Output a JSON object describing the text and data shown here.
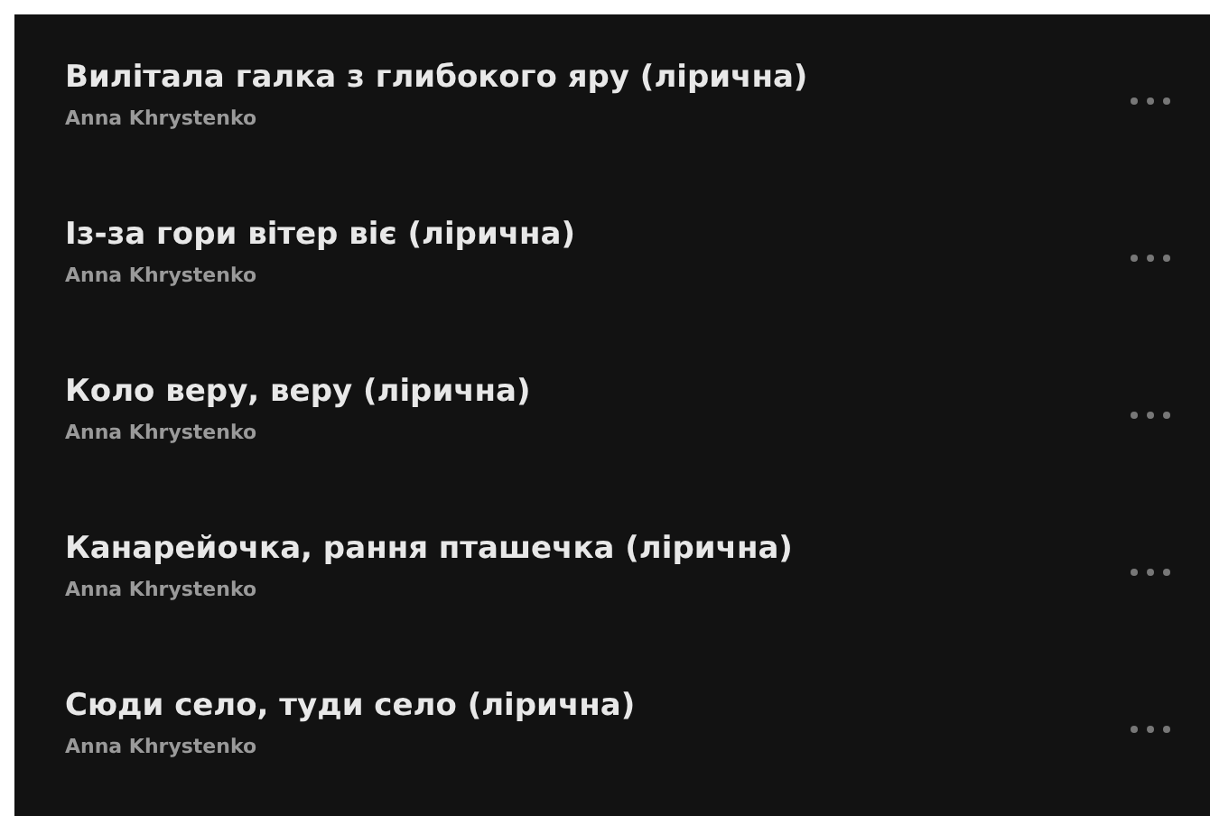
{
  "tracks": [
    {
      "title": "Вилітала галка з глибокого яру (лірична)",
      "artist": "Anna Khrystenko"
    },
    {
      "title": "Із-за гори вітер віє (лірична)",
      "artist": "Anna Khrystenko"
    },
    {
      "title": "Коло веру, веру (лірична)",
      "artist": "Anna Khrystenko"
    },
    {
      "title": "Канарейочка, рання пташечка (лірична)",
      "artist": "Anna Khrystenko"
    },
    {
      "title": "Сюди село, туди село (лірична)",
      "artist": "Anna Khrystenko"
    }
  ]
}
